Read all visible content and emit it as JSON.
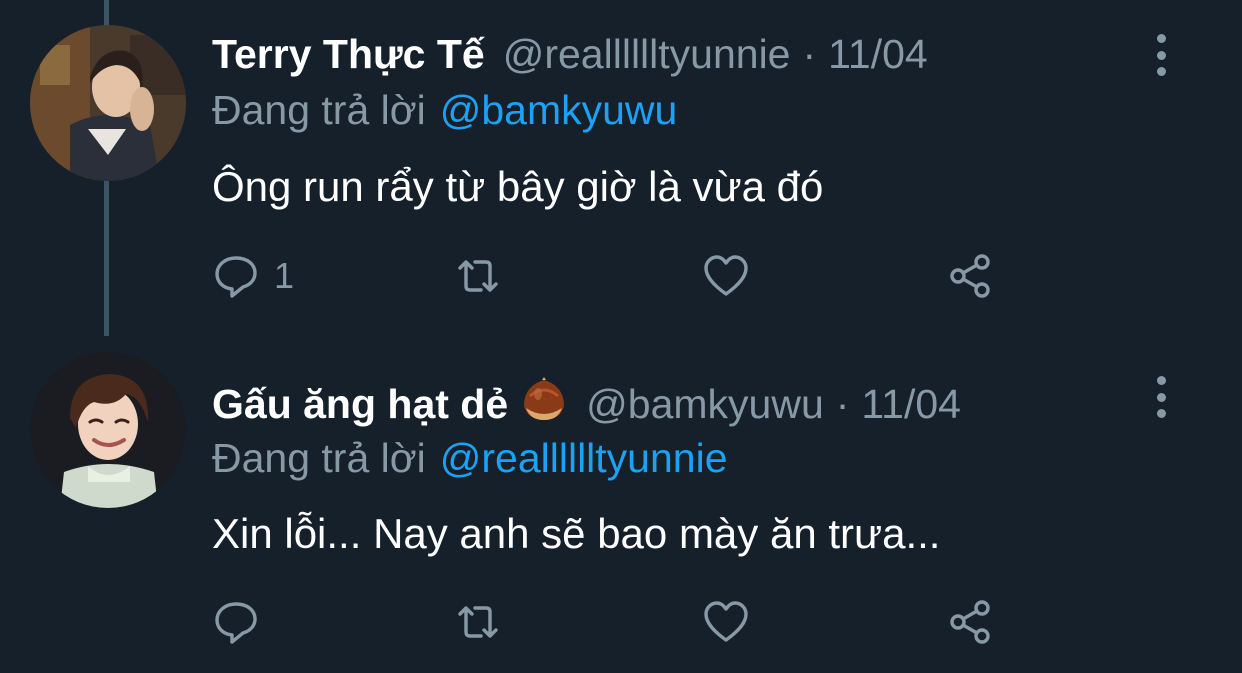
{
  "colors": {
    "background": "#15202b",
    "primary_text": "#ffffff",
    "secondary_text": "#8899a6",
    "link": "#1da1f2",
    "thread_line": "#3d5466"
  },
  "tweets": [
    {
      "display_name": "Terry Thực Tế",
      "handle": "@realllllltyunnie",
      "separator": "·",
      "date": "11/04",
      "reply_prefix": "Đang trả lời",
      "reply_to": "@bamkyuwu",
      "text": "Ông run rẩy từ bây giờ là vừa đó",
      "reply_count": "1",
      "icons": [
        "reply-icon",
        "retweet-icon",
        "like-icon",
        "share-icon",
        "more-icon"
      ]
    },
    {
      "display_name": "Gấu ăng hạt dẻ",
      "emoji": "chestnut-emoji",
      "handle": "@bamkyuwu",
      "separator": "·",
      "date": "11/04",
      "reply_prefix": "Đang trả lời",
      "reply_to": "@realllllltyunnie",
      "text": "Xin lỗi... Nay anh sẽ bao mày ăn trưa...",
      "reply_count": "",
      "icons": [
        "reply-icon",
        "retweet-icon",
        "like-icon",
        "share-icon",
        "more-icon"
      ]
    }
  ]
}
